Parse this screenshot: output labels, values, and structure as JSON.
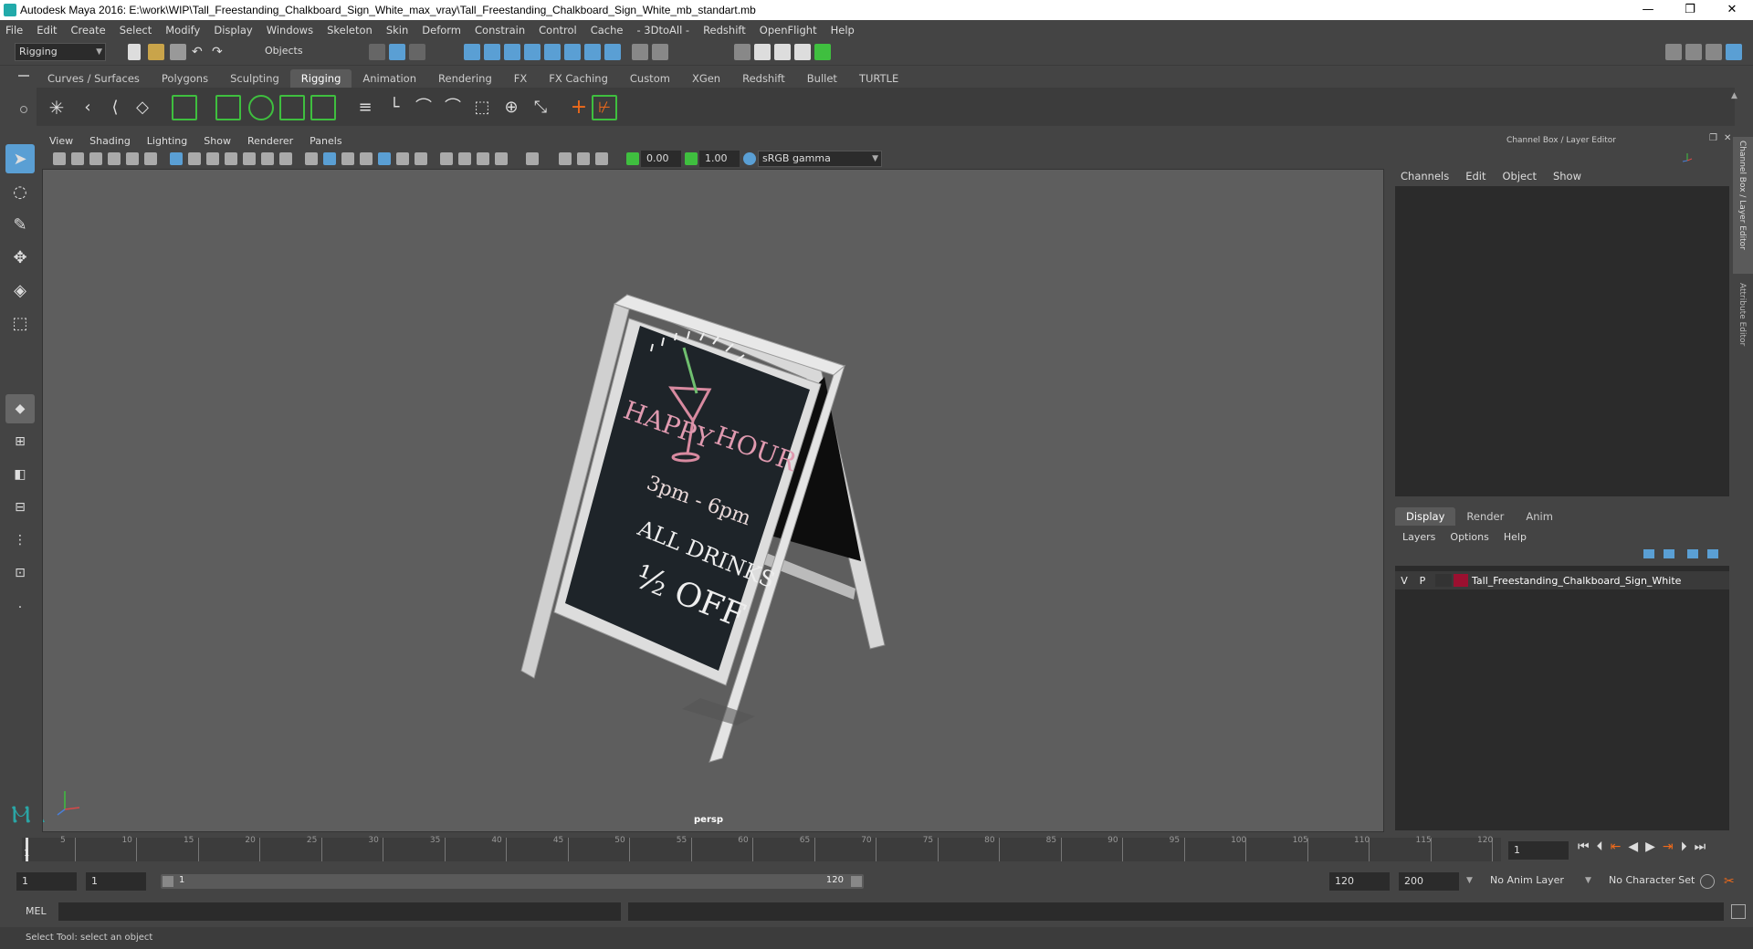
{
  "window": {
    "title": "Autodesk Maya 2016: E:\\work\\WIP\\Tall_Freestanding_Chalkboard_Sign_White_max_vray\\Tall_Freestanding_Chalkboard_Sign_White_mb_standart.mb",
    "controls": [
      "—",
      "❐",
      "✕"
    ]
  },
  "menubar": [
    "File",
    "Edit",
    "Create",
    "Select",
    "Modify",
    "Display",
    "Windows",
    "Skeleton",
    "Skin",
    "Deform",
    "Constrain",
    "Control",
    "Cache",
    "- 3DtoAll -",
    "Redshift",
    "OpenFlight",
    "Help"
  ],
  "statusline": {
    "mode": "Rigging",
    "selection_mask": "Objects"
  },
  "shelf_tabs": [
    {
      "label": "Curves / Surfaces",
      "active": false
    },
    {
      "label": "Polygons",
      "active": false
    },
    {
      "label": "Sculpting",
      "active": false
    },
    {
      "label": "Rigging",
      "active": true
    },
    {
      "label": "Animation",
      "active": false
    },
    {
      "label": "Rendering",
      "active": false
    },
    {
      "label": "FX",
      "active": false
    },
    {
      "label": "FX Caching",
      "active": false
    },
    {
      "label": "Custom",
      "active": false
    },
    {
      "label": "XGen",
      "active": false
    },
    {
      "label": "Redshift",
      "active": false
    },
    {
      "label": "Bullet",
      "active": false
    },
    {
      "label": "TURTLE",
      "active": false
    }
  ],
  "viewport": {
    "menu": [
      "View",
      "Shading",
      "Lighting",
      "Show",
      "Renderer",
      "Panels"
    ],
    "exposure": "0.00",
    "gamma": "1.00",
    "color_space": "sRGB gamma",
    "camera": "persp"
  },
  "chalkboard": {
    "line1a": "HAPPY",
    "line1b": "HOUR",
    "line2": "3pm - 6pm",
    "line3": "ALL DRINKS",
    "line4": "½ OFF"
  },
  "channel_box": {
    "title": "Channel Box / Layer Editor",
    "menu": [
      "Channels",
      "Edit",
      "Object",
      "Show"
    ],
    "layer_tabs": [
      {
        "label": "Display",
        "active": true
      },
      {
        "label": "Render",
        "active": false
      },
      {
        "label": "Anim",
        "active": false
      }
    ],
    "layer_menu": [
      "Layers",
      "Options",
      "Help"
    ],
    "layer": {
      "v": "V",
      "p": "P",
      "name": "Tall_Freestanding_Chalkboard_Sign_White",
      "color": "#9b1030"
    },
    "side_tabs": [
      "Channel Box / Layer Editor",
      "Attribute Editor"
    ]
  },
  "timeline": {
    "ticks": [
      "1",
      "5",
      "10",
      "15",
      "20",
      "25",
      "30",
      "35",
      "40",
      "45",
      "50",
      "55",
      "60",
      "65",
      "70",
      "75",
      "80",
      "85",
      "90",
      "95",
      "100",
      "105",
      "110",
      "115",
      "120"
    ],
    "current_frame": "1"
  },
  "range": {
    "start": "1",
    "playback_start": "1",
    "slider_start": "1",
    "slider_end": "120",
    "playback_end": "120",
    "end": "200",
    "anim_layer": "No Anim Layer",
    "character_set": "No Character Set"
  },
  "command": {
    "label": "MEL"
  },
  "help_line": "Select Tool: select an object",
  "colors": {
    "accent_green": "#3fbf3f",
    "accent_blue": "#5a9fd4",
    "viewport_bg": "#5e5e5e",
    "panel_bg": "#444444"
  }
}
